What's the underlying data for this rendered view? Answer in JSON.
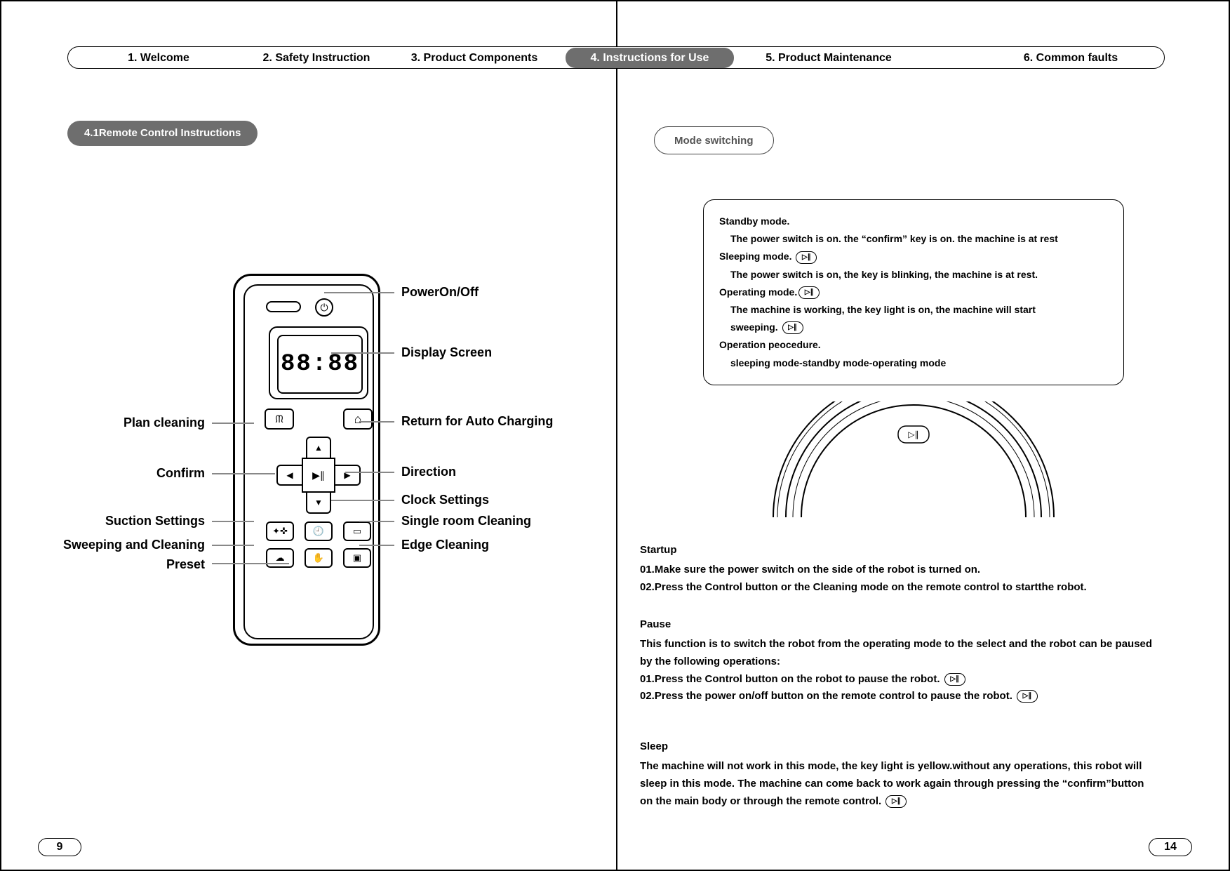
{
  "tabs": {
    "t1": "1. Welcome",
    "t2": "2. Safety Instruction",
    "t3": "3. Product Components",
    "t4": "4. Instructions for Use",
    "t5": "5. Product Maintenance",
    "t6": "6. Common faults"
  },
  "left_page": {
    "section_badge": "4.1Remote Control Instructions",
    "lcd": "88:88",
    "labels": {
      "power": "PowerOn/Off",
      "display": "Display Screen",
      "plan_cleaning": "Plan cleaning",
      "return_auto": "Return for Auto Charging",
      "confirm": "Confirm",
      "direction": "Direction",
      "clock": "Clock Settings",
      "suction": "Suction Settings",
      "single_room": "Single room Cleaning",
      "sweeping": "Sweeping and Cleaning",
      "edge": "Edge Cleaning",
      "preset": "Preset"
    },
    "icons": {
      "power": "⏻",
      "plan": "ᙏ",
      "home": "⌂",
      "up": "▲",
      "down": "▼",
      "left": "◀",
      "right": "▶",
      "center": "▶∥",
      "suction": "✦✜",
      "clock": "🕘",
      "tool": "▭",
      "sweep": "☁",
      "hand": "✋",
      "room": "▣"
    }
  },
  "right_page": {
    "mode_switching": "Mode switching",
    "mode_box": {
      "standby_h": "Standby mode.",
      "standby_b": "The power switch is on. the “confirm” key is on. the machine is at rest",
      "sleeping_h": "Sleeping mode. ",
      "sleeping_b": "The power switch is on, the key is blinking, the machine is at rest.",
      "operating_h": "Operating mode.",
      "operating_b1": "The machine is working, the key light is on, the machine will start",
      "operating_b2": "sweeping. ",
      "procedure_h": "Operation peocedure.",
      "procedure_b": "sleeping mode-standby mode-operating mode"
    },
    "play_icon": "▷∥",
    "startup_h": "Startup",
    "startup_1": "01.Make sure the power switch on the side of the robot is turned on.",
    "startup_2": "02.Press the Control button or the Cleaning mode on the remote control to startthe robot.",
    "pause_h": " Pause",
    "pause_intro": "This function is to switch the robot from the operating mode to the select and the robot can be paused by the following operations:",
    "pause_1": "01.Press the Control button on the robot to pause the robot. ",
    "pause_2": "02.Press the power on/off button on the remote control to pause the robot. ",
    "sleep_h": "Sleep",
    "sleep_b": "The machine will not work in this mode, the key light is yellow.without any operations, this robot will sleep in this mode. The machine can come back to work again through pressing the “confirm”button on the main body or through the remote control. "
  },
  "page_numbers": {
    "left": "9",
    "right": "14"
  }
}
